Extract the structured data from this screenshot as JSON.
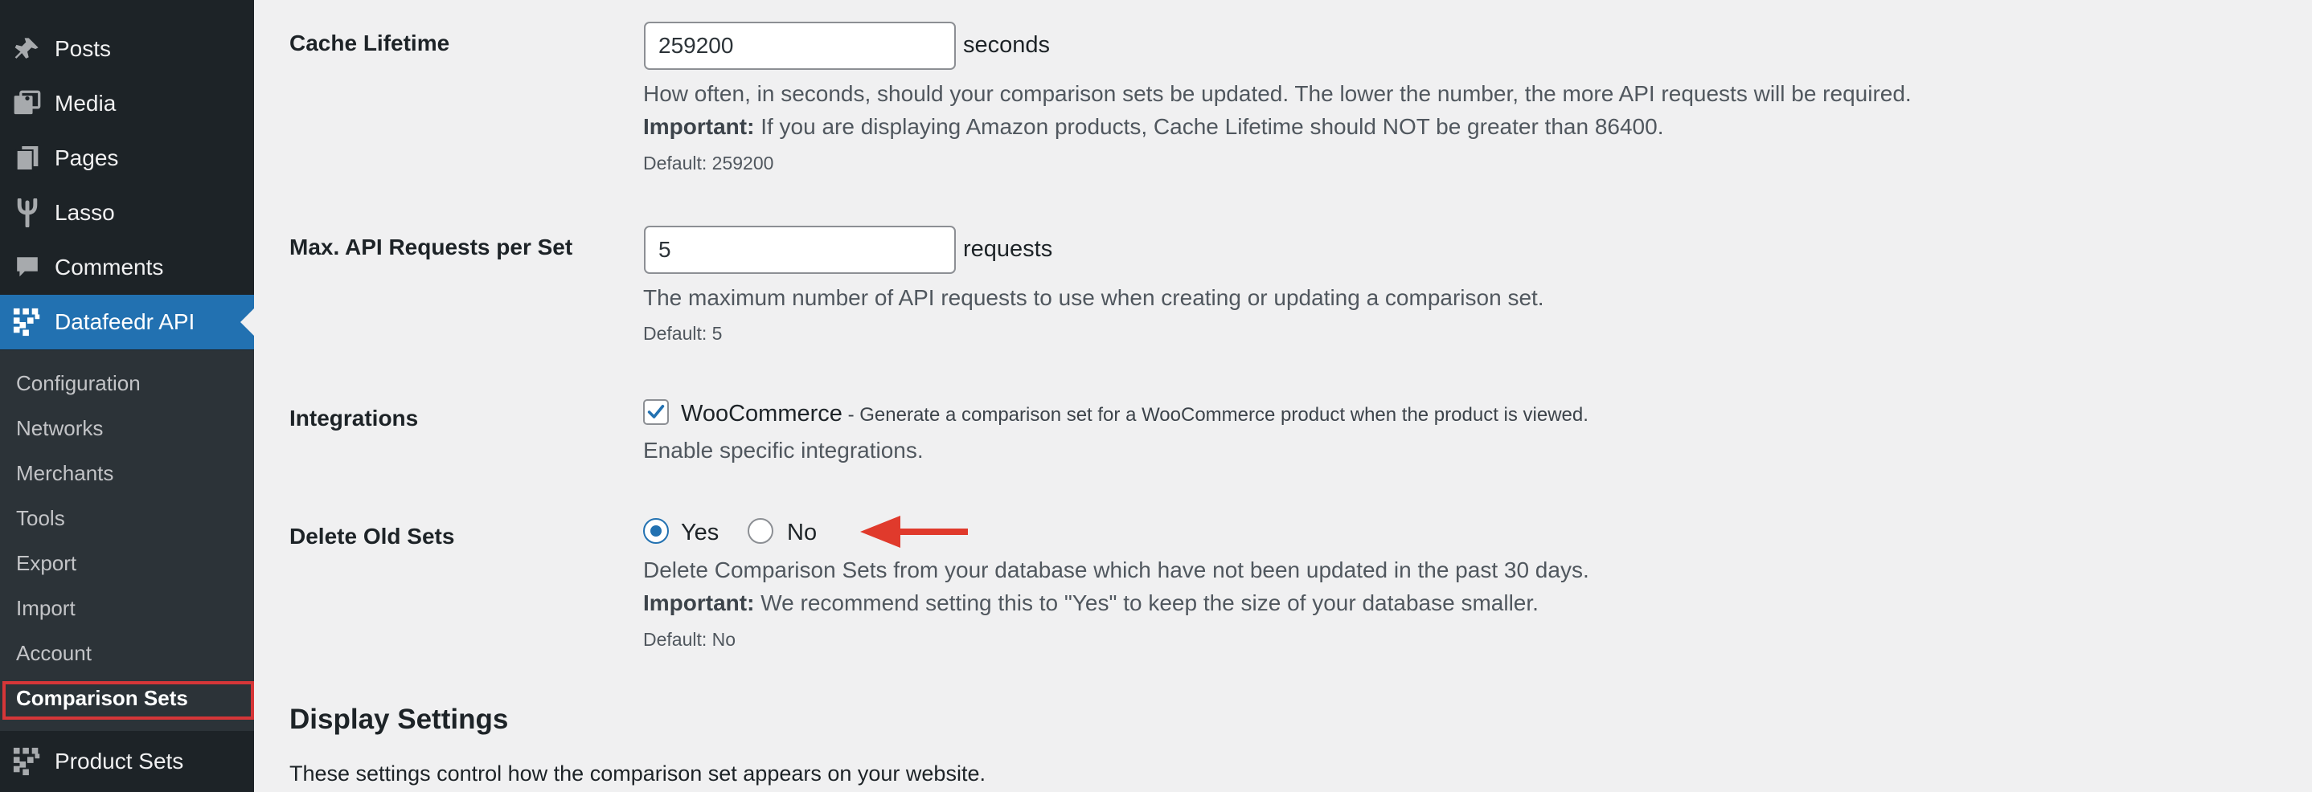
{
  "sidebar": {
    "items": [
      {
        "label": "Posts",
        "icon": "pin-icon"
      },
      {
        "label": "Media",
        "icon": "media-icon"
      },
      {
        "label": "Pages",
        "icon": "pages-icon"
      },
      {
        "label": "Lasso",
        "icon": "lasso-icon"
      },
      {
        "label": "Comments",
        "icon": "comment-icon"
      },
      {
        "label": "Datafeedr API",
        "icon": "datafeedr-icon",
        "active": true
      }
    ],
    "submenu": [
      {
        "label": "Configuration"
      },
      {
        "label": "Networks"
      },
      {
        "label": "Merchants"
      },
      {
        "label": "Tools"
      },
      {
        "label": "Export"
      },
      {
        "label": "Import"
      },
      {
        "label": "Account"
      },
      {
        "label": "Comparison Sets",
        "current": true
      }
    ],
    "after": {
      "label": "Product Sets",
      "icon": "datafeedr-icon"
    }
  },
  "settings": {
    "cache_lifetime": {
      "label": "Cache Lifetime",
      "value": "259200",
      "unit": "seconds",
      "desc": "How often, in seconds, should your comparison sets be updated. The lower the number, the more API requests will be required.",
      "important_label": "Important:",
      "important_text": " If you are displaying Amazon products, Cache Lifetime should NOT be greater than 86400.",
      "default": "Default: 259200"
    },
    "max_requests": {
      "label": "Max. API Requests per Set",
      "value": "5",
      "unit": "requests",
      "desc": "The maximum number of API requests to use when creating or updating a comparison set.",
      "default": "Default: 5"
    },
    "integrations": {
      "label": "Integrations",
      "checkbox_label": "WooCommerce",
      "checkbox_hint": " - Generate a comparison set for a WooCommerce product when the product is viewed.",
      "checked": true,
      "desc": "Enable specific integrations."
    },
    "delete_old_sets": {
      "label": "Delete Old Sets",
      "options": [
        "Yes",
        "No"
      ],
      "selected": "Yes",
      "desc": "Delete Comparison Sets from your database which have not been updated in the past 30 days.",
      "important_label": "Important:",
      "important_text": " We recommend setting this to \"Yes\" to keep the size of your database smaller.",
      "default": "Default: No"
    }
  },
  "display_settings": {
    "title": "Display Settings",
    "desc": "These settings control how the comparison set appears on your website."
  },
  "colors": {
    "sidebar_bg": "#1d2327",
    "submenu_bg": "#2c3338",
    "accent": "#2271b1",
    "highlight": "#d63638",
    "arrow": "#e03a2c"
  }
}
